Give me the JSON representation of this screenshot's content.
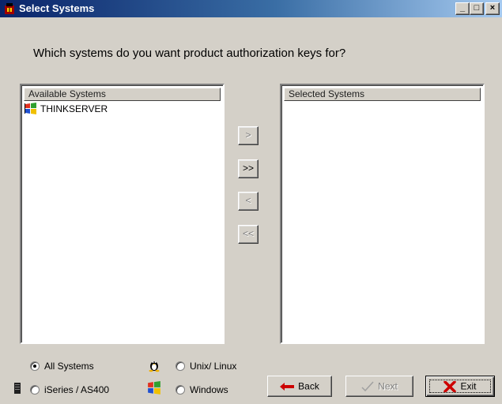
{
  "window": {
    "title": "Select Systems",
    "controls": {
      "minimize": "_",
      "maximize": "□",
      "close": "×"
    }
  },
  "question": "Which systems do you want product authorization keys for?",
  "available": {
    "header": "Available Systems",
    "items": [
      {
        "label": "THINKSERVER",
        "icon": "windows-logo-icon"
      }
    ]
  },
  "selected": {
    "header": "Selected Systems",
    "items": []
  },
  "move_buttons": {
    "add": ">",
    "add_all": ">>",
    "remove": "<",
    "remove_all": "<<"
  },
  "filters": {
    "all_systems": {
      "label": "All Systems",
      "checked": true
    },
    "unix_linux": {
      "label": "Unix/ Linux",
      "checked": false
    },
    "iseries": {
      "label": "iSeries / AS400",
      "checked": false
    },
    "windows": {
      "label": "Windows",
      "checked": false
    }
  },
  "buttons": {
    "back": {
      "label": "Back",
      "enabled": true
    },
    "next": {
      "label": "Next",
      "enabled": false
    },
    "exit": {
      "label": "Exit",
      "enabled": true,
      "default": true
    }
  },
  "colors": {
    "titlebar_start": "#0a246a",
    "titlebar_end": "#a6caf0",
    "face": "#d4d0c8",
    "exit_x": "#cc0000",
    "back_arrow": "#cc0000"
  }
}
